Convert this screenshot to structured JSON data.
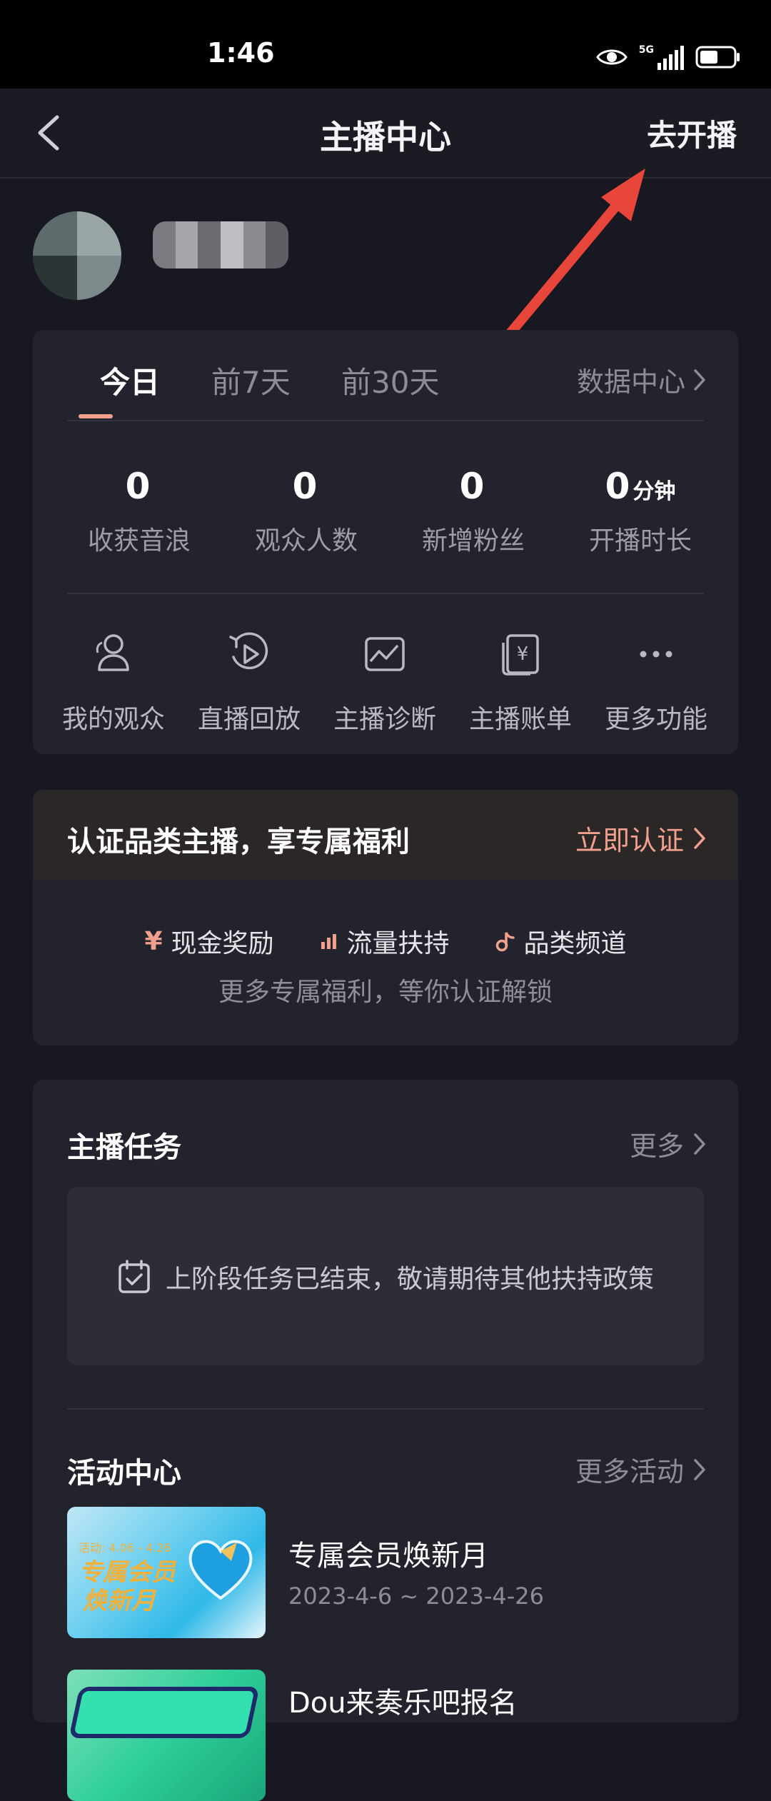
{
  "status": {
    "time": "1:46",
    "network": "5G"
  },
  "nav": {
    "title": "主播中心",
    "go_live": "去开播"
  },
  "tabs": [
    {
      "label": "今日"
    },
    {
      "label": "前7天"
    },
    {
      "label": "前30天"
    }
  ],
  "data_center": "数据中心",
  "stats": [
    {
      "value": "0",
      "unit": "",
      "label": "收获音浪"
    },
    {
      "value": "0",
      "unit": "",
      "label": "观众人数"
    },
    {
      "value": "0",
      "unit": "",
      "label": "新增粉丝"
    },
    {
      "value": "0",
      "unit": "分钟",
      "label": "开播时长"
    }
  ],
  "tools": [
    {
      "label": "我的观众",
      "icon": "audience-icon"
    },
    {
      "label": "直播回放",
      "icon": "replay-icon"
    },
    {
      "label": "主播诊断",
      "icon": "diagnosis-icon"
    },
    {
      "label": "主播账单",
      "icon": "bill-icon"
    },
    {
      "label": "更多功能",
      "icon": "more-icon"
    }
  ],
  "certification": {
    "title": "认证品类主播，享专属福利",
    "action": "立即认证",
    "benefits": [
      {
        "icon_text": "¥",
        "label": "现金奖励"
      },
      {
        "icon_text": "",
        "label": "流量扶持"
      },
      {
        "icon_text": "",
        "label": "品类频道"
      }
    ],
    "subtitle": "更多专属福利，等你认证解锁",
    "accent": "#f2a08e"
  },
  "tasks": {
    "title": "主播任务",
    "more": "更多",
    "message": "上阶段任务已结束，敬请期待其他扶持政策"
  },
  "activities": {
    "title": "活动中心",
    "more": "更多活动",
    "items": [
      {
        "title": "专属会员焕新月",
        "date": "2023-4-6 ~ 2023-4-26",
        "thumb_caption": "活动: 4.06 - 4.26",
        "thumb_text_1": "专属会员",
        "thumb_text_2": "焕新月"
      },
      {
        "title": "Dou来奏乐吧报名",
        "date": "",
        "thumb_caption": "",
        "thumb_text_1": "",
        "thumb_text_2": ""
      }
    ]
  }
}
